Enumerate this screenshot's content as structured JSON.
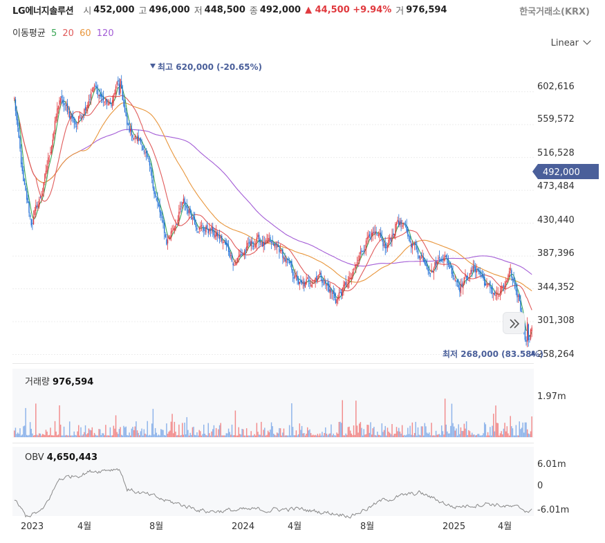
{
  "header": {
    "name": "LG에너지솔루션",
    "open_label": "시",
    "open": "452,000",
    "high_label": "고",
    "high": "496,000",
    "low_label": "저",
    "low": "448,500",
    "close_label": "종",
    "close": "492,000",
    "change": "▲ 44,500 +9.94%",
    "volume_label": "거",
    "volume": "976,594",
    "exchange": "한국거래소(KRX)"
  },
  "ma_legend": {
    "title": "이동평균",
    "p5": "5",
    "p20": "20",
    "p60": "60",
    "p120": "120"
  },
  "scale_selector": "Linear",
  "price_axis": [
    "602,616",
    "559,572",
    "516,528",
    "473,484",
    "430,440",
    "387,396",
    "344,352",
    "301,308",
    "258,264"
  ],
  "current_price_tag": "492,000",
  "annotations": {
    "high": "최고 620,000 (-20.65%)",
    "low": "최저 268,000 (83.58%)"
  },
  "volume_panel": {
    "label": "거래량",
    "value": "976,594",
    "axis": "1.97m"
  },
  "obv_panel": {
    "label": "OBV",
    "value": "4,650,443",
    "axis": [
      "6.01m",
      "0",
      "-6.01m"
    ]
  },
  "x_labels": [
    "2023",
    "4월",
    "8월",
    "2024",
    "4월",
    "8월",
    "2025",
    "4월"
  ],
  "colors": {
    "up": "#e0393e",
    "down": "#1f6fd6",
    "ma5": "#3aa655",
    "ma20": "#e05a5a",
    "ma60": "#e8953a",
    "ma120": "#a35cd6",
    "tag": "#4a5f9a",
    "obv": "#888888"
  },
  "chart_data": {
    "type": "candlestick",
    "x_range": [
      "2023-01",
      "2025-06"
    ],
    "y_range": [
      258264,
      620000
    ],
    "anchors": [
      [
        0,
        592000
      ],
      [
        8,
        480000
      ],
      [
        15,
        430000
      ],
      [
        25,
        472000
      ],
      [
        40,
        592000
      ],
      [
        55,
        560000
      ],
      [
        70,
        608000
      ],
      [
        85,
        582000
      ],
      [
        93,
        620000
      ],
      [
        100,
        555000
      ],
      [
        115,
        530000
      ],
      [
        135,
        405000
      ],
      [
        150,
        455000
      ],
      [
        165,
        425000
      ],
      [
        175,
        420000
      ],
      [
        185,
        405000
      ],
      [
        195,
        380000
      ],
      [
        215,
        408000
      ],
      [
        235,
        395000
      ],
      [
        255,
        345000
      ],
      [
        270,
        365000
      ],
      [
        285,
        330000
      ],
      [
        300,
        360000
      ],
      [
        315,
        420000
      ],
      [
        330,
        395000
      ],
      [
        340,
        435000
      ],
      [
        355,
        400000
      ],
      [
        370,
        370000
      ],
      [
        380,
        390000
      ],
      [
        395,
        350000
      ],
      [
        410,
        372000
      ],
      [
        420,
        345000
      ],
      [
        430,
        335000
      ],
      [
        440,
        360000
      ],
      [
        448,
        330000
      ],
      [
        455,
        268000
      ],
      [
        459,
        292000
      ]
    ],
    "high": 620000,
    "low": 268000,
    "last_close": 492000,
    "volume_max": 1970000,
    "obv_range": [
      -6010000,
      6010000
    ],
    "obv_last": 4650443
  }
}
